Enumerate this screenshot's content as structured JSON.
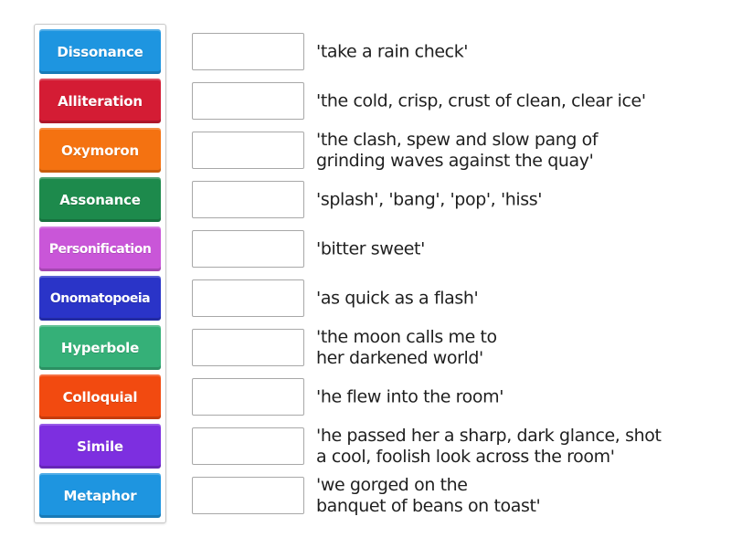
{
  "terms": [
    {
      "label": "Dissonance",
      "color": "#1e95e0"
    },
    {
      "label": "Alliteration",
      "color": "#d41c34"
    },
    {
      "label": "Oxymoron",
      "color": "#f47211"
    },
    {
      "label": "Assonance",
      "color": "#1d8a4c"
    },
    {
      "label": "Personification",
      "color": "#c956d8"
    },
    {
      "label": "Onomatopoeia",
      "color": "#2a34c8"
    },
    {
      "label": "Hyperbole",
      "color": "#35b078"
    },
    {
      "label": "Colloquial",
      "color": "#f24a10"
    },
    {
      "label": "Simile",
      "color": "#7d2fe0"
    },
    {
      "label": "Metaphor",
      "color": "#1e95e0"
    }
  ],
  "clues": [
    {
      "lines": [
        "'take a rain check'"
      ],
      "answer": ""
    },
    {
      "lines": [
        "'the cold, crisp, crust of clean, clear ice'"
      ],
      "answer": ""
    },
    {
      "lines": [
        "'the clash, spew and slow pang of",
        "grinding waves against the quay'"
      ],
      "answer": ""
    },
    {
      "lines": [
        "'splash', 'bang', 'pop', 'hiss'"
      ],
      "answer": ""
    },
    {
      "lines": [
        "'bitter sweet'"
      ],
      "answer": ""
    },
    {
      "lines": [
        "'as quick as a flash'"
      ],
      "answer": ""
    },
    {
      "lines": [
        "'the moon calls me to",
        "her darkened world'"
      ],
      "answer": ""
    },
    {
      "lines": [
        "'he flew into the room'"
      ],
      "answer": ""
    },
    {
      "lines": [
        "'he passed her a sharp, dark glance, shot",
        "a cool, foolish look across the room'"
      ],
      "answer": ""
    },
    {
      "lines": [
        "'we gorged on the",
        "banquet of beans on toast'"
      ],
      "answer": ""
    }
  ]
}
